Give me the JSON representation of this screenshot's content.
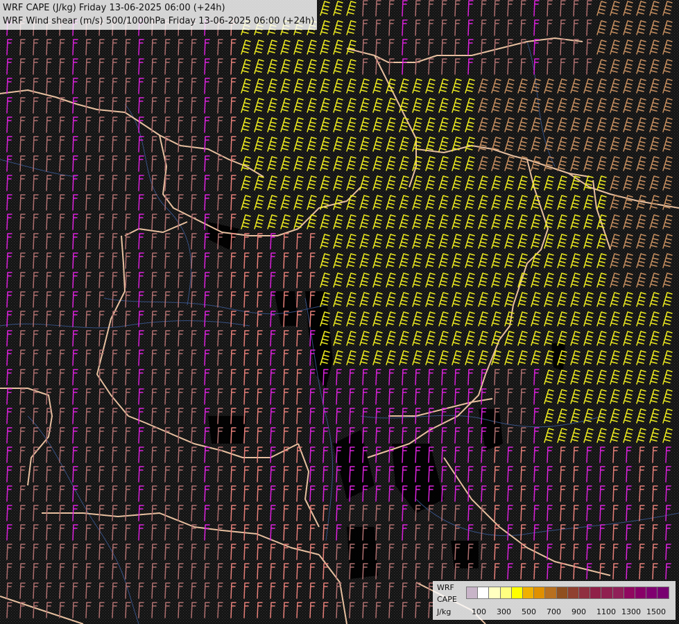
{
  "title": {
    "line1": "WRF CAPE (J/kg) Friday 13-06-2025 06:00 (+24h)",
    "line2": "WRF Wind shear (m/s) 500/1000hPa Friday 13-06-2025 06:00 (+24h)"
  },
  "legend": {
    "label1": "WRF",
    "label2": "CAPE",
    "unit": "J/kg",
    "swatch_colors": [
      "#c8b4c8",
      "#ffffff",
      "#ffffc0",
      "#ffff80",
      "#ffff00",
      "#f0b000",
      "#e09000",
      "#b87020",
      "#905020",
      "#904030",
      "#903040",
      "#902048",
      "#902050",
      "#902058",
      "#900860",
      "#880068",
      "#800070",
      "#780070"
    ],
    "ticks": [
      "100",
      "300",
      "500",
      "700",
      "900",
      "1100",
      "1300",
      "1500"
    ]
  },
  "map": {
    "barb_colors": {
      "magenta": "#dd22dd",
      "salmon": "#e8807a",
      "brown": "#b07070",
      "tan": "#c89060",
      "yellow": "#f0ee20",
      "lightyellow": "#e8e860"
    },
    "border_color": "#e8c0a0",
    "river_color": "#4060a0",
    "background": "#141414"
  }
}
